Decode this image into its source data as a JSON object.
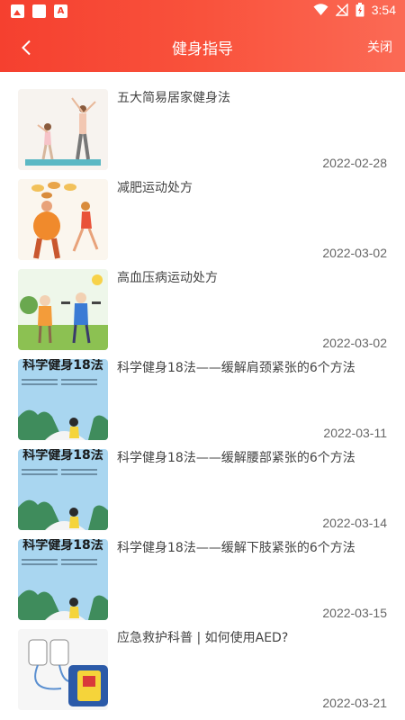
{
  "status_bar": {
    "time": "3:54"
  },
  "header": {
    "title": "健身指导",
    "close_label": "关闭"
  },
  "items": [
    {
      "title": "五大简易居家健身法",
      "date": "2022-02-28",
      "thumb": "home-workout-image"
    },
    {
      "title": "减肥运动处方",
      "date": "2022-03-02",
      "thumb": "weight-loss-image"
    },
    {
      "title": "高血压病运动处方",
      "date": "2022-03-02",
      "thumb": "hypertension-exercise-image"
    },
    {
      "title": "科学健身18法——缓解肩颈紧张的6个方法",
      "date": "2022-03-11",
      "thumb": "fitness-18-poster",
      "thumb_text": "科学健身18法"
    },
    {
      "title": "科学健身18法——缓解腰部紧张的6个方法",
      "date": "2022-03-14",
      "thumb": "fitness-18-poster",
      "thumb_text": "科学健身18法"
    },
    {
      "title": "科学健身18法——缓解下肢紧张的6个方法",
      "date": "2022-03-15",
      "thumb": "fitness-18-poster",
      "thumb_text": "科学健身18法"
    },
    {
      "title": "应急救护科普 | 如何使用AED?",
      "date": "2022-03-21",
      "thumb": "aed-device-image"
    }
  ]
}
